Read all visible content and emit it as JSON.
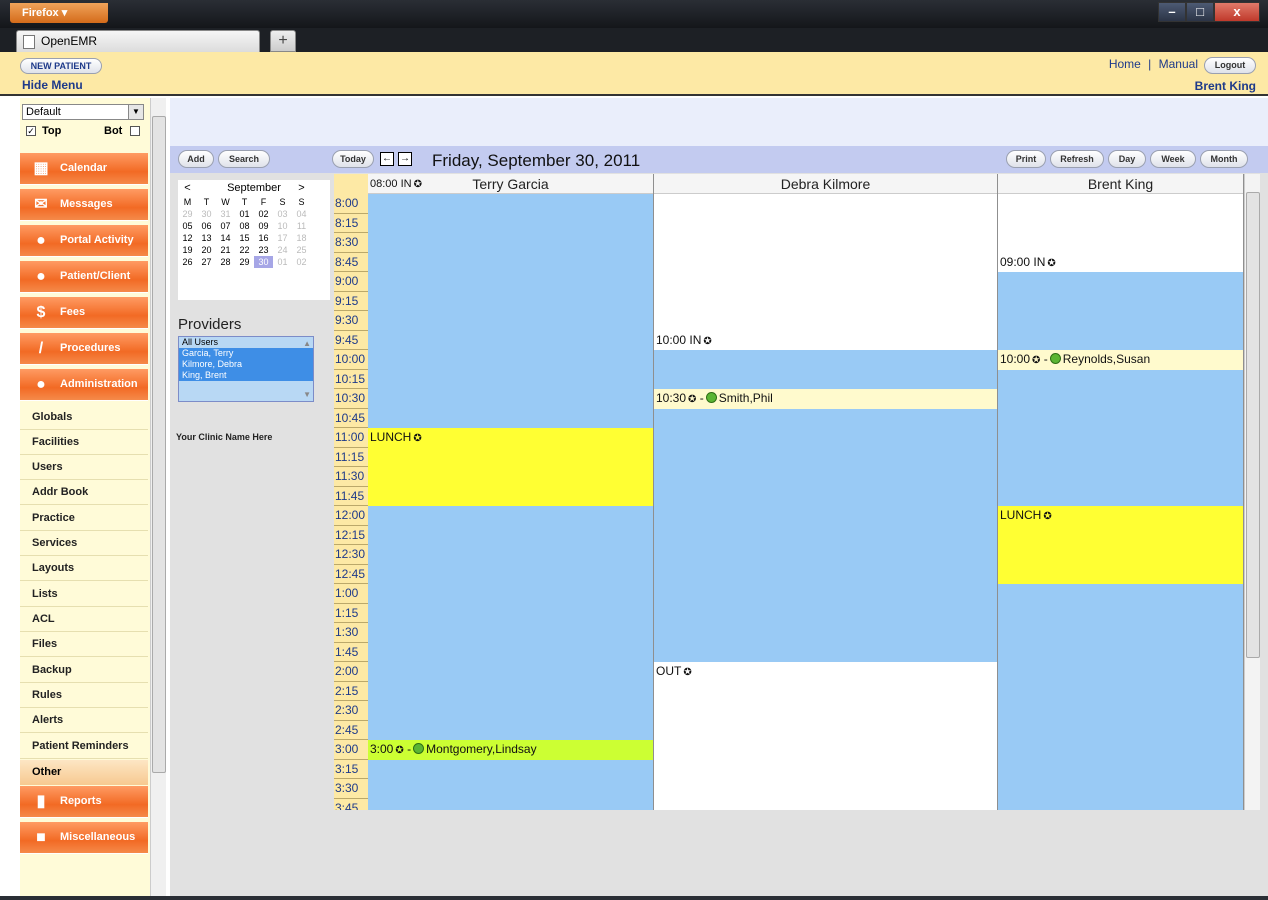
{
  "browser": {
    "app_button": "Firefox",
    "tab_title": "OpenEMR",
    "new_tab_glyph": "+",
    "window_controls": [
      "–",
      "□",
      "x"
    ]
  },
  "header": {
    "new_patient_label": "NEW PATIENT",
    "hide_menu_label": "Hide Menu",
    "home_link": "Home",
    "separator": "|",
    "manual_link": "Manual",
    "logout_label": "Logout",
    "user_name": "Brent King"
  },
  "sidebar": {
    "frame_select": "Default",
    "top_label": "Top",
    "bot_label": "Bot",
    "top_checked": true,
    "bot_checked": false,
    "nav_buttons": [
      {
        "label": "Calendar",
        "icon": "calendar-icon"
      },
      {
        "label": "Messages",
        "icon": "envelope-icon"
      },
      {
        "label": "Portal Activity",
        "icon": "person-icon"
      },
      {
        "label": "Patient/Client",
        "icon": "person-icon"
      },
      {
        "label": "Fees",
        "icon": "money-icon"
      },
      {
        "label": "Procedures",
        "icon": "syringe-icon"
      },
      {
        "label": "Administration",
        "icon": "admin-person-icon"
      }
    ],
    "admin_items": [
      "Globals",
      "Facilities",
      "Users",
      "Addr Book",
      "Practice",
      "Services",
      "Layouts",
      "Lists",
      "ACL",
      "Files",
      "Backup",
      "Rules",
      "Alerts",
      "Patient Reminders"
    ],
    "other_label": "Other",
    "bottom_buttons": [
      {
        "label": "Reports",
        "icon": "chart-icon"
      },
      {
        "label": "Miscellaneous",
        "icon": "box-icon"
      }
    ]
  },
  "toolbar": {
    "add_label": "Add",
    "search_label": "Search",
    "today_label": "Today",
    "date_title": "Friday, September 30, 2011",
    "print_label": "Print",
    "refresh_label": "Refresh",
    "day_label": "Day",
    "week_label": "Week",
    "month_label": "Month"
  },
  "mini_calendar": {
    "prev": "<",
    "next": ">",
    "month": "September",
    "weekdays": [
      "M",
      "T",
      "W",
      "T",
      "F",
      "S",
      "S"
    ],
    "weeks": [
      [
        "29",
        "30",
        "31",
        "01",
        "02",
        "03",
        "04"
      ],
      [
        "05",
        "06",
        "07",
        "08",
        "09",
        "10",
        "11"
      ],
      [
        "12",
        "13",
        "14",
        "15",
        "16",
        "17",
        "18"
      ],
      [
        "19",
        "20",
        "21",
        "22",
        "23",
        "24",
        "25"
      ],
      [
        "26",
        "27",
        "28",
        "29",
        "30",
        "01",
        "02"
      ]
    ],
    "selected": "30"
  },
  "providers": {
    "heading": "Providers",
    "items": [
      "All Users",
      "Garcia, Terry",
      "Kilmore, Debra",
      "King, Brent"
    ]
  },
  "clinic_name": "Your Clinic Name Here",
  "schedule": {
    "start_minutes": 480,
    "slot_minutes": 15,
    "times": [
      "8:00",
      "8:15",
      "8:30",
      "8:45",
      "9:00",
      "9:15",
      "9:30",
      "9:45",
      "10:00",
      "10:15",
      "10:30",
      "10:45",
      "11:00",
      "11:15",
      "11:30",
      "11:45",
      "12:00",
      "12:15",
      "12:30",
      "12:45",
      "1:00",
      "1:15",
      "1:30",
      "1:45",
      "2:00",
      "2:15",
      "2:30",
      "2:45",
      "3:00",
      "3:15",
      "3:30",
      "3:45"
    ],
    "providers": [
      {
        "name": "Terry Garcia",
        "in_label": "08:00 IN",
        "available": [
          {
            "start": 480,
            "end": 960
          }
        ],
        "events": [
          {
            "label": "LUNCH",
            "start": 660,
            "end": 720,
            "kind": "lunch",
            "patient": false
          },
          {
            "label": "3:00",
            "patient_name": "Montgomery,Lindsay",
            "start": 900,
            "end": 915,
            "kind": "appt-green",
            "patient": true
          }
        ]
      },
      {
        "name": "Debra Kilmore",
        "in_label": "10:00 IN",
        "in_start": 585,
        "out_label": "OUT",
        "out_start": 840,
        "available": [
          {
            "start": 600,
            "end": 840
          }
        ],
        "events": [
          {
            "label": "10:30",
            "patient_name": "Smith,Phil",
            "start": 630,
            "end": 645,
            "kind": "appt",
            "patient": true
          }
        ]
      },
      {
        "name": "Brent King",
        "in_label": "09:00 IN",
        "in_start": 525,
        "available": [
          {
            "start": 540,
            "end": 960
          }
        ],
        "events": [
          {
            "label": "10:00",
            "patient_name": "Reynolds,Susan",
            "start": 600,
            "end": 615,
            "kind": "appt",
            "patient": true
          },
          {
            "label": "LUNCH",
            "start": 720,
            "end": 780,
            "kind": "lunch",
            "patient": false
          }
        ]
      }
    ]
  },
  "colors": {
    "available": "#99caf5",
    "lunch": "#ffff33",
    "appointment": "#fffacd",
    "appointment_green": "#ccff33",
    "nav_orange": "#f26a24",
    "header_bg": "#fde9a5"
  }
}
